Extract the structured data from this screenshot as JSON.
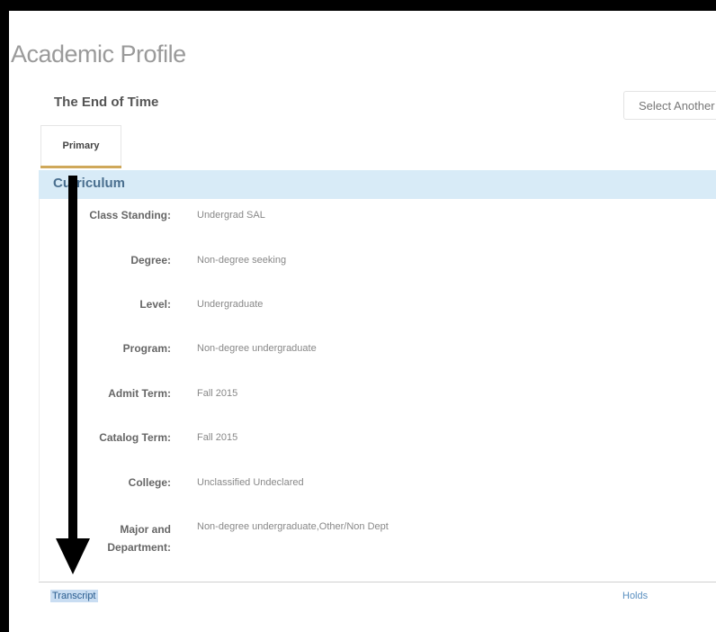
{
  "page": {
    "title": "Academic Profile"
  },
  "student": {
    "name": "The End of Time"
  },
  "select_button": {
    "label": "Select Another"
  },
  "tabs": [
    {
      "label": "Primary",
      "active": true
    }
  ],
  "section": {
    "title": "Curriculum"
  },
  "fields": [
    {
      "label": "Class Standing:",
      "value": "Undergrad SAL"
    },
    {
      "label": "Degree:",
      "value": "Non-degree seeking"
    },
    {
      "label": "Level:",
      "value": "Undergraduate"
    },
    {
      "label": "Program:",
      "value": "Non-degree undergraduate"
    },
    {
      "label": "Admit Term:",
      "value": "Fall 2015"
    },
    {
      "label": "Catalog Term:",
      "value": "Fall 2015"
    },
    {
      "label": "College:",
      "value": "Unclassified Undeclared"
    },
    {
      "label": "Major and Department:",
      "value": "Non-degree undergraduate,Other/Non Dept"
    }
  ],
  "footer": {
    "transcript": "Transcript",
    "holds": "Holds"
  },
  "colors": {
    "accent_tab": "#cfa85a",
    "section_bg": "#d8ebf7",
    "link": "#2a5d8f"
  }
}
